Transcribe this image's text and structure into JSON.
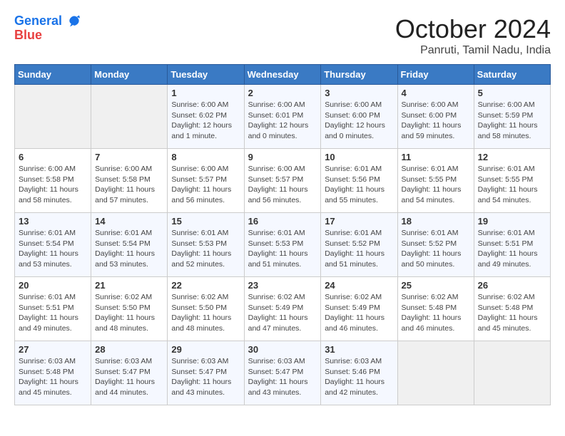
{
  "header": {
    "logo_line1": "General",
    "logo_line2": "Blue",
    "month_title": "October 2024",
    "location": "Panruti, Tamil Nadu, India"
  },
  "calendar": {
    "days_of_week": [
      "Sunday",
      "Monday",
      "Tuesday",
      "Wednesday",
      "Thursday",
      "Friday",
      "Saturday"
    ],
    "weeks": [
      [
        {
          "day": "",
          "info": ""
        },
        {
          "day": "",
          "info": ""
        },
        {
          "day": "1",
          "info": "Sunrise: 6:00 AM\nSunset: 6:02 PM\nDaylight: 12 hours and 1 minute."
        },
        {
          "day": "2",
          "info": "Sunrise: 6:00 AM\nSunset: 6:01 PM\nDaylight: 12 hours and 0 minutes."
        },
        {
          "day": "3",
          "info": "Sunrise: 6:00 AM\nSunset: 6:00 PM\nDaylight: 12 hours and 0 minutes."
        },
        {
          "day": "4",
          "info": "Sunrise: 6:00 AM\nSunset: 6:00 PM\nDaylight: 11 hours and 59 minutes."
        },
        {
          "day": "5",
          "info": "Sunrise: 6:00 AM\nSunset: 5:59 PM\nDaylight: 11 hours and 58 minutes."
        }
      ],
      [
        {
          "day": "6",
          "info": "Sunrise: 6:00 AM\nSunset: 5:58 PM\nDaylight: 11 hours and 58 minutes."
        },
        {
          "day": "7",
          "info": "Sunrise: 6:00 AM\nSunset: 5:58 PM\nDaylight: 11 hours and 57 minutes."
        },
        {
          "day": "8",
          "info": "Sunrise: 6:00 AM\nSunset: 5:57 PM\nDaylight: 11 hours and 56 minutes."
        },
        {
          "day": "9",
          "info": "Sunrise: 6:00 AM\nSunset: 5:57 PM\nDaylight: 11 hours and 56 minutes."
        },
        {
          "day": "10",
          "info": "Sunrise: 6:01 AM\nSunset: 5:56 PM\nDaylight: 11 hours and 55 minutes."
        },
        {
          "day": "11",
          "info": "Sunrise: 6:01 AM\nSunset: 5:55 PM\nDaylight: 11 hours and 54 minutes."
        },
        {
          "day": "12",
          "info": "Sunrise: 6:01 AM\nSunset: 5:55 PM\nDaylight: 11 hours and 54 minutes."
        }
      ],
      [
        {
          "day": "13",
          "info": "Sunrise: 6:01 AM\nSunset: 5:54 PM\nDaylight: 11 hours and 53 minutes."
        },
        {
          "day": "14",
          "info": "Sunrise: 6:01 AM\nSunset: 5:54 PM\nDaylight: 11 hours and 53 minutes."
        },
        {
          "day": "15",
          "info": "Sunrise: 6:01 AM\nSunset: 5:53 PM\nDaylight: 11 hours and 52 minutes."
        },
        {
          "day": "16",
          "info": "Sunrise: 6:01 AM\nSunset: 5:53 PM\nDaylight: 11 hours and 51 minutes."
        },
        {
          "day": "17",
          "info": "Sunrise: 6:01 AM\nSunset: 5:52 PM\nDaylight: 11 hours and 51 minutes."
        },
        {
          "day": "18",
          "info": "Sunrise: 6:01 AM\nSunset: 5:52 PM\nDaylight: 11 hours and 50 minutes."
        },
        {
          "day": "19",
          "info": "Sunrise: 6:01 AM\nSunset: 5:51 PM\nDaylight: 11 hours and 49 minutes."
        }
      ],
      [
        {
          "day": "20",
          "info": "Sunrise: 6:01 AM\nSunset: 5:51 PM\nDaylight: 11 hours and 49 minutes."
        },
        {
          "day": "21",
          "info": "Sunrise: 6:02 AM\nSunset: 5:50 PM\nDaylight: 11 hours and 48 minutes."
        },
        {
          "day": "22",
          "info": "Sunrise: 6:02 AM\nSunset: 5:50 PM\nDaylight: 11 hours and 48 minutes."
        },
        {
          "day": "23",
          "info": "Sunrise: 6:02 AM\nSunset: 5:49 PM\nDaylight: 11 hours and 47 minutes."
        },
        {
          "day": "24",
          "info": "Sunrise: 6:02 AM\nSunset: 5:49 PM\nDaylight: 11 hours and 46 minutes."
        },
        {
          "day": "25",
          "info": "Sunrise: 6:02 AM\nSunset: 5:48 PM\nDaylight: 11 hours and 46 minutes."
        },
        {
          "day": "26",
          "info": "Sunrise: 6:02 AM\nSunset: 5:48 PM\nDaylight: 11 hours and 45 minutes."
        }
      ],
      [
        {
          "day": "27",
          "info": "Sunrise: 6:03 AM\nSunset: 5:48 PM\nDaylight: 11 hours and 45 minutes."
        },
        {
          "day": "28",
          "info": "Sunrise: 6:03 AM\nSunset: 5:47 PM\nDaylight: 11 hours and 44 minutes."
        },
        {
          "day": "29",
          "info": "Sunrise: 6:03 AM\nSunset: 5:47 PM\nDaylight: 11 hours and 43 minutes."
        },
        {
          "day": "30",
          "info": "Sunrise: 6:03 AM\nSunset: 5:47 PM\nDaylight: 11 hours and 43 minutes."
        },
        {
          "day": "31",
          "info": "Sunrise: 6:03 AM\nSunset: 5:46 PM\nDaylight: 11 hours and 42 minutes."
        },
        {
          "day": "",
          "info": ""
        },
        {
          "day": "",
          "info": ""
        }
      ]
    ]
  }
}
